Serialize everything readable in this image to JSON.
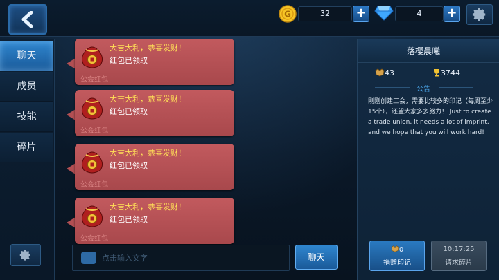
{
  "topbar": {
    "back_icon": "back-arrow-icon",
    "gold": {
      "icon": "gold-coin-icon",
      "value": "32",
      "add_label": "+"
    },
    "diamond": {
      "icon": "diamond-icon",
      "value": "4",
      "add_label": "+"
    },
    "settings_icon": "gear-icon"
  },
  "sidebar": {
    "tabs": [
      {
        "label": "聊天",
        "active": true
      },
      {
        "label": "成员",
        "active": false
      },
      {
        "label": "技能",
        "active": false
      },
      {
        "label": "碎片",
        "active": false
      }
    ],
    "settings_icon": "gear-icon"
  },
  "chat": {
    "messages": [
      {
        "title": "大吉大利，恭喜发财！",
        "status": "红包已领取",
        "tag": "公会红包",
        "icon": "red-packet-bag-icon"
      },
      {
        "title": "大吉大利，恭喜发财！",
        "status": "红包已领取",
        "tag": "公会红包",
        "icon": "red-packet-bag-icon"
      },
      {
        "title": "大吉大利，恭喜发财！",
        "status": "红包已领取",
        "tag": "公会红包",
        "icon": "red-packet-bag-icon"
      },
      {
        "title": "大吉大利，恭喜发财！",
        "status": "红包已领取",
        "tag": "公会红包",
        "icon": "red-packet-bag-icon"
      }
    ],
    "input_placeholder": "点击输入文字",
    "send_label": "聊天"
  },
  "guild": {
    "name": "落樱晨曦",
    "level_badge": "43",
    "trophies": "3744",
    "notice_label": "公告",
    "notice_text": "刚刚创建工会，需要比较多的印记（每周至少15个），还望大家多多努力！ Just to create a trade union, it needs a lot of imprint, and we hope that you will work hard!",
    "donate": {
      "count": "0",
      "label": "捐赠印记"
    },
    "request": {
      "timer": "10:17:25",
      "label": "请求碎片"
    }
  },
  "colors": {
    "accent": "#2f86cf",
    "bubble": "#b24f53",
    "gold_text": "#ffdf57"
  }
}
